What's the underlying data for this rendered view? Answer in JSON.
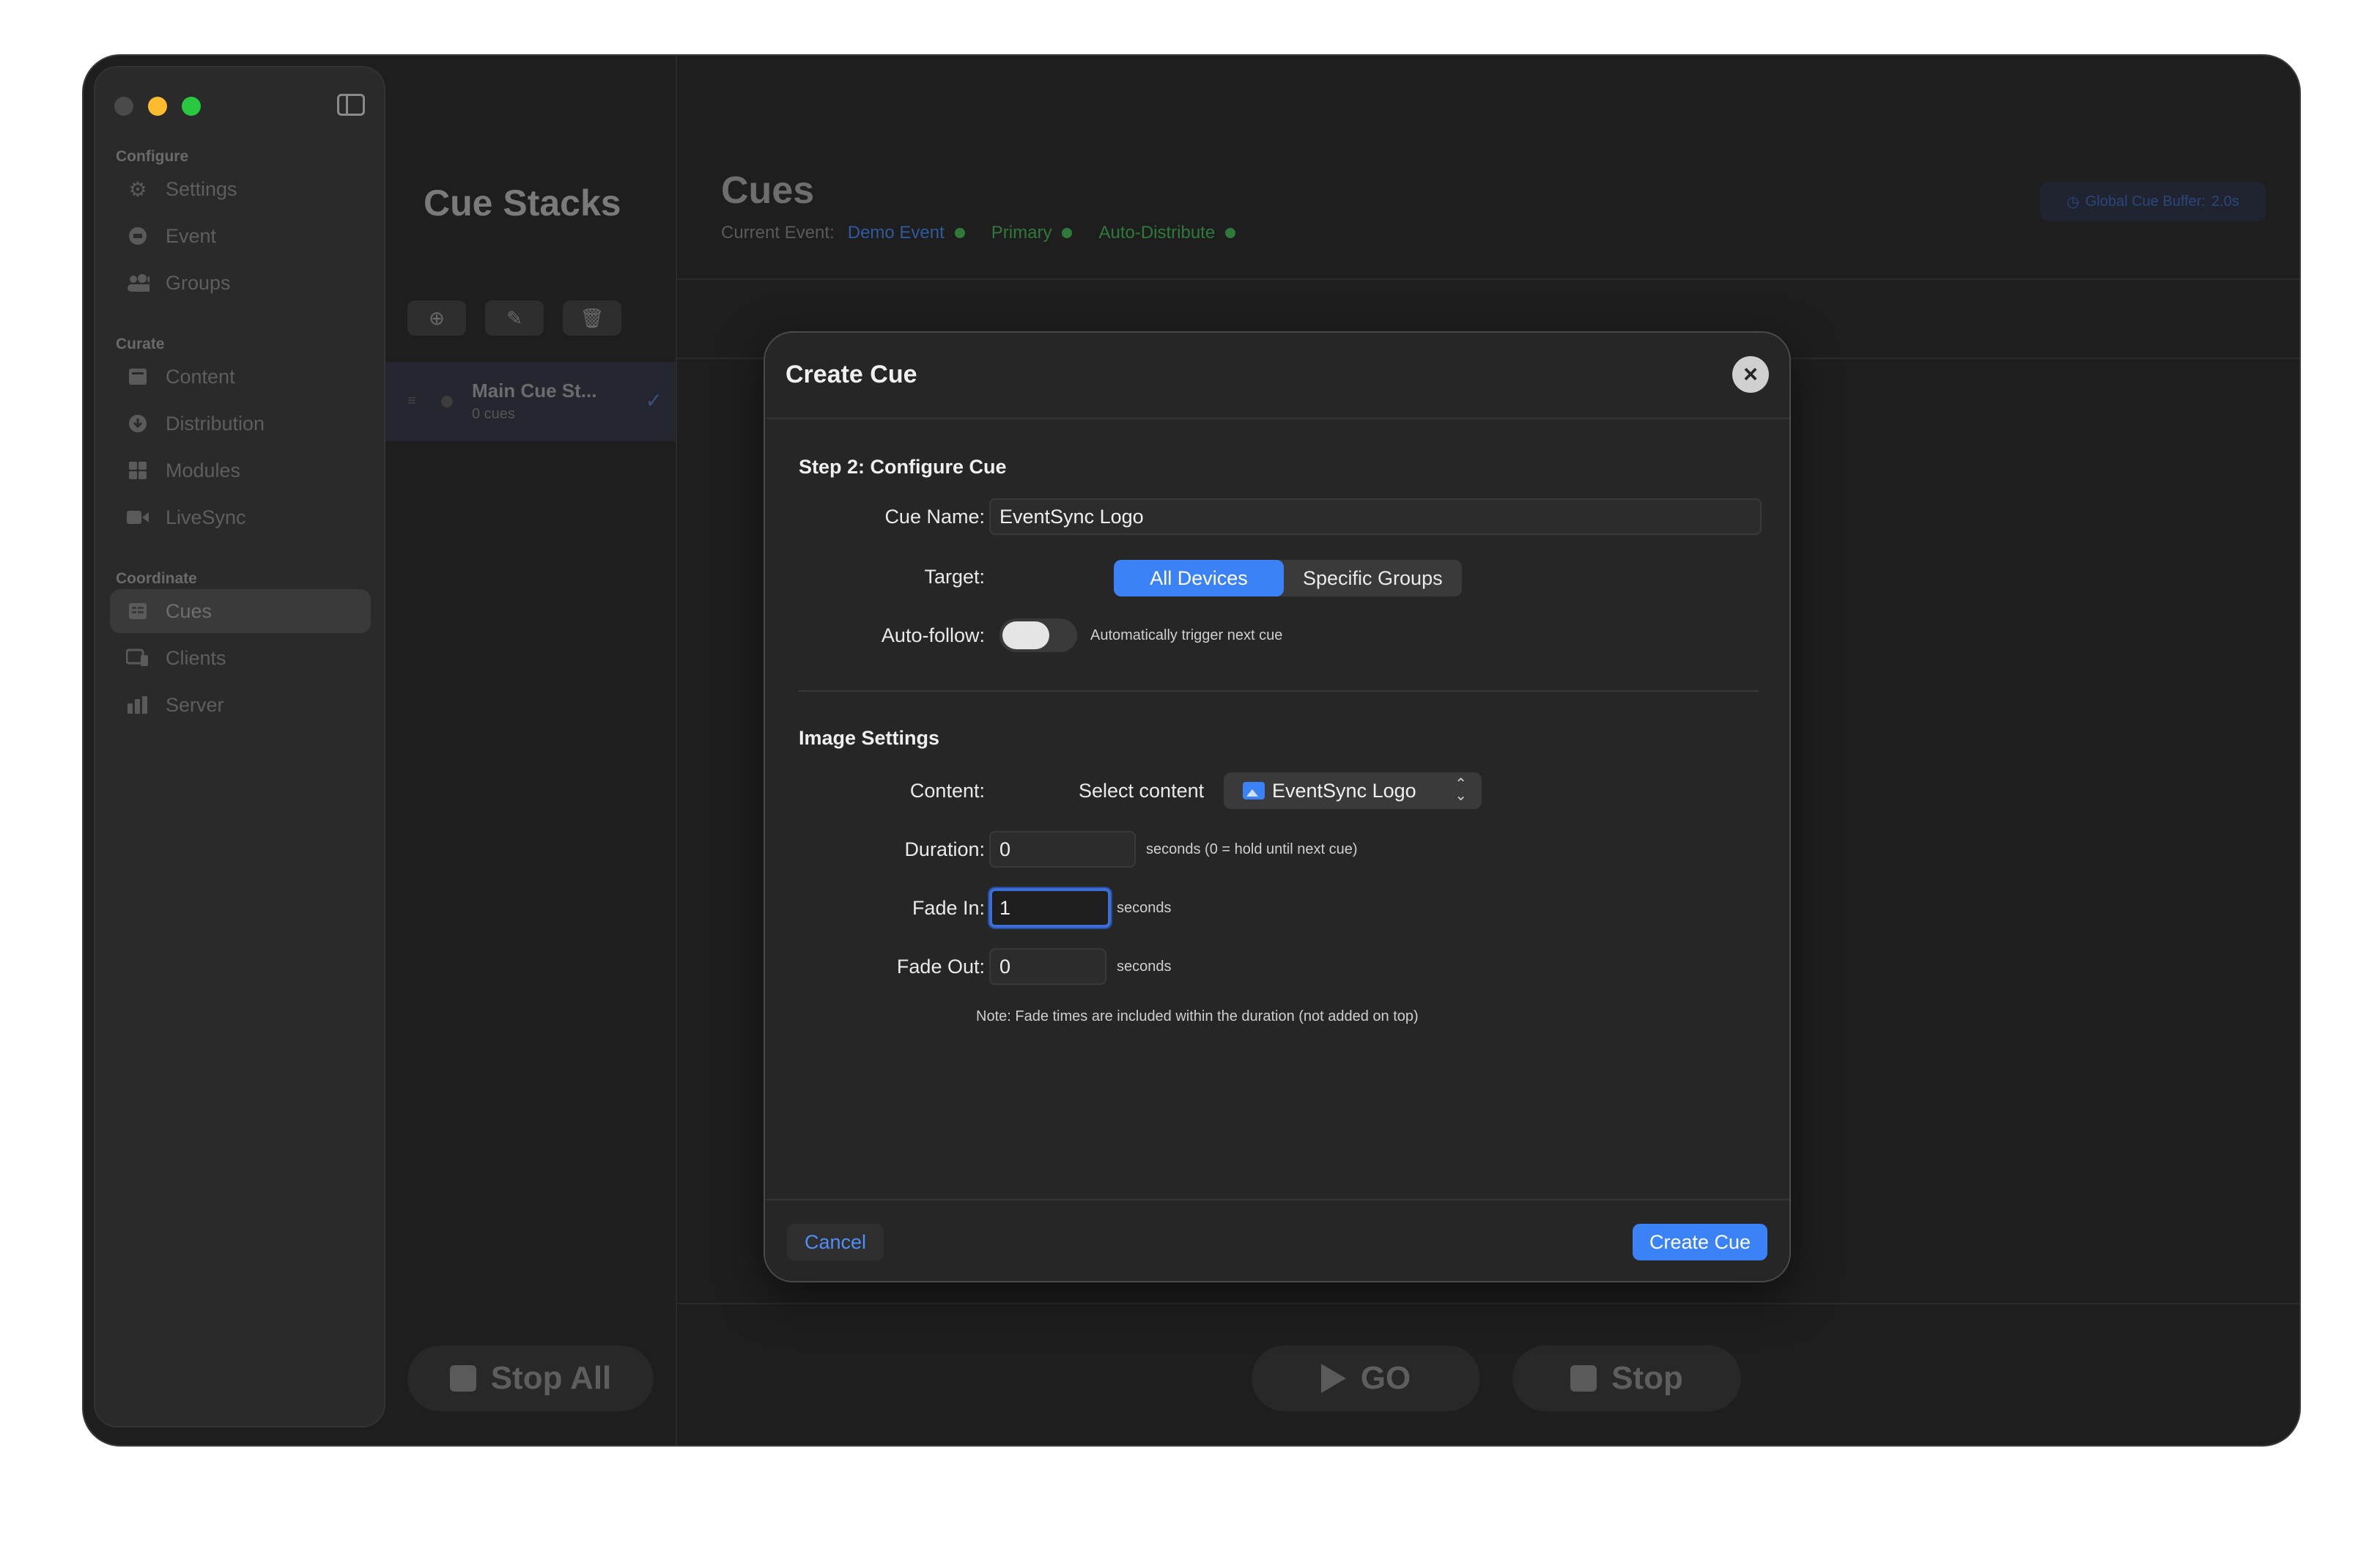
{
  "sidebar": {
    "sections": [
      {
        "title": "Configure",
        "items": [
          {
            "label": "Settings",
            "icon": "gear-icon"
          },
          {
            "label": "Event",
            "icon": "event-icon"
          },
          {
            "label": "Groups",
            "icon": "groups-icon"
          }
        ]
      },
      {
        "title": "Curate",
        "items": [
          {
            "label": "Content",
            "icon": "content-icon"
          },
          {
            "label": "Distribution",
            "icon": "distribution-icon"
          },
          {
            "label": "Modules",
            "icon": "modules-icon"
          },
          {
            "label": "LiveSync",
            "icon": "video-icon"
          }
        ]
      },
      {
        "title": "Coordinate",
        "items": [
          {
            "label": "Cues",
            "icon": "cues-icon",
            "active": true
          },
          {
            "label": "Clients",
            "icon": "clients-icon"
          },
          {
            "label": "Server",
            "icon": "server-icon"
          }
        ]
      }
    ]
  },
  "stacks": {
    "title": "Cue Stacks",
    "row": {
      "name": "Main Cue St...",
      "sub": "0 cues"
    },
    "stop_all": "Stop All"
  },
  "cues": {
    "title": "Cues",
    "current_event_label": "Current Event:",
    "event_name": "Demo Event",
    "status_primary": "Primary",
    "status_auto": "Auto-Distribute",
    "buffer": "Global Cue Buffer:",
    "buffer_value": "2.0s",
    "go": "GO",
    "stop": "Stop"
  },
  "dialog": {
    "title": "Create Cue",
    "step_title": "Step 2: Configure Cue",
    "cue_name_label": "Cue Name:",
    "cue_name_value": "EventSync Logo",
    "target_label": "Target:",
    "target_options": [
      "All Devices",
      "Specific Groups"
    ],
    "target_selected": "All Devices",
    "autofollow_label": "Auto-follow:",
    "autofollow_on": false,
    "autofollow_hint": "Automatically trigger next cue",
    "image_settings_title": "Image Settings",
    "content_label": "Content:",
    "select_content_label": "Select content",
    "content_value": "EventSync Logo",
    "duration_label": "Duration:",
    "duration_value": "0",
    "duration_hint": "seconds (0 = hold until next cue)",
    "fade_in_label": "Fade In:",
    "fade_in_value": "1",
    "fade_in_hint": "seconds",
    "fade_out_label": "Fade Out:",
    "fade_out_value": "0",
    "fade_out_hint": "seconds",
    "note": "Note: Fade times are included within the duration (not added on top)",
    "cancel": "Cancel",
    "create": "Create Cue"
  },
  "colors": {
    "accent": "#3b82f6",
    "close": "#ff5f57",
    "minimize": "#febc2e",
    "maximize": "#28c840",
    "status_green": "#2f7a3b"
  }
}
